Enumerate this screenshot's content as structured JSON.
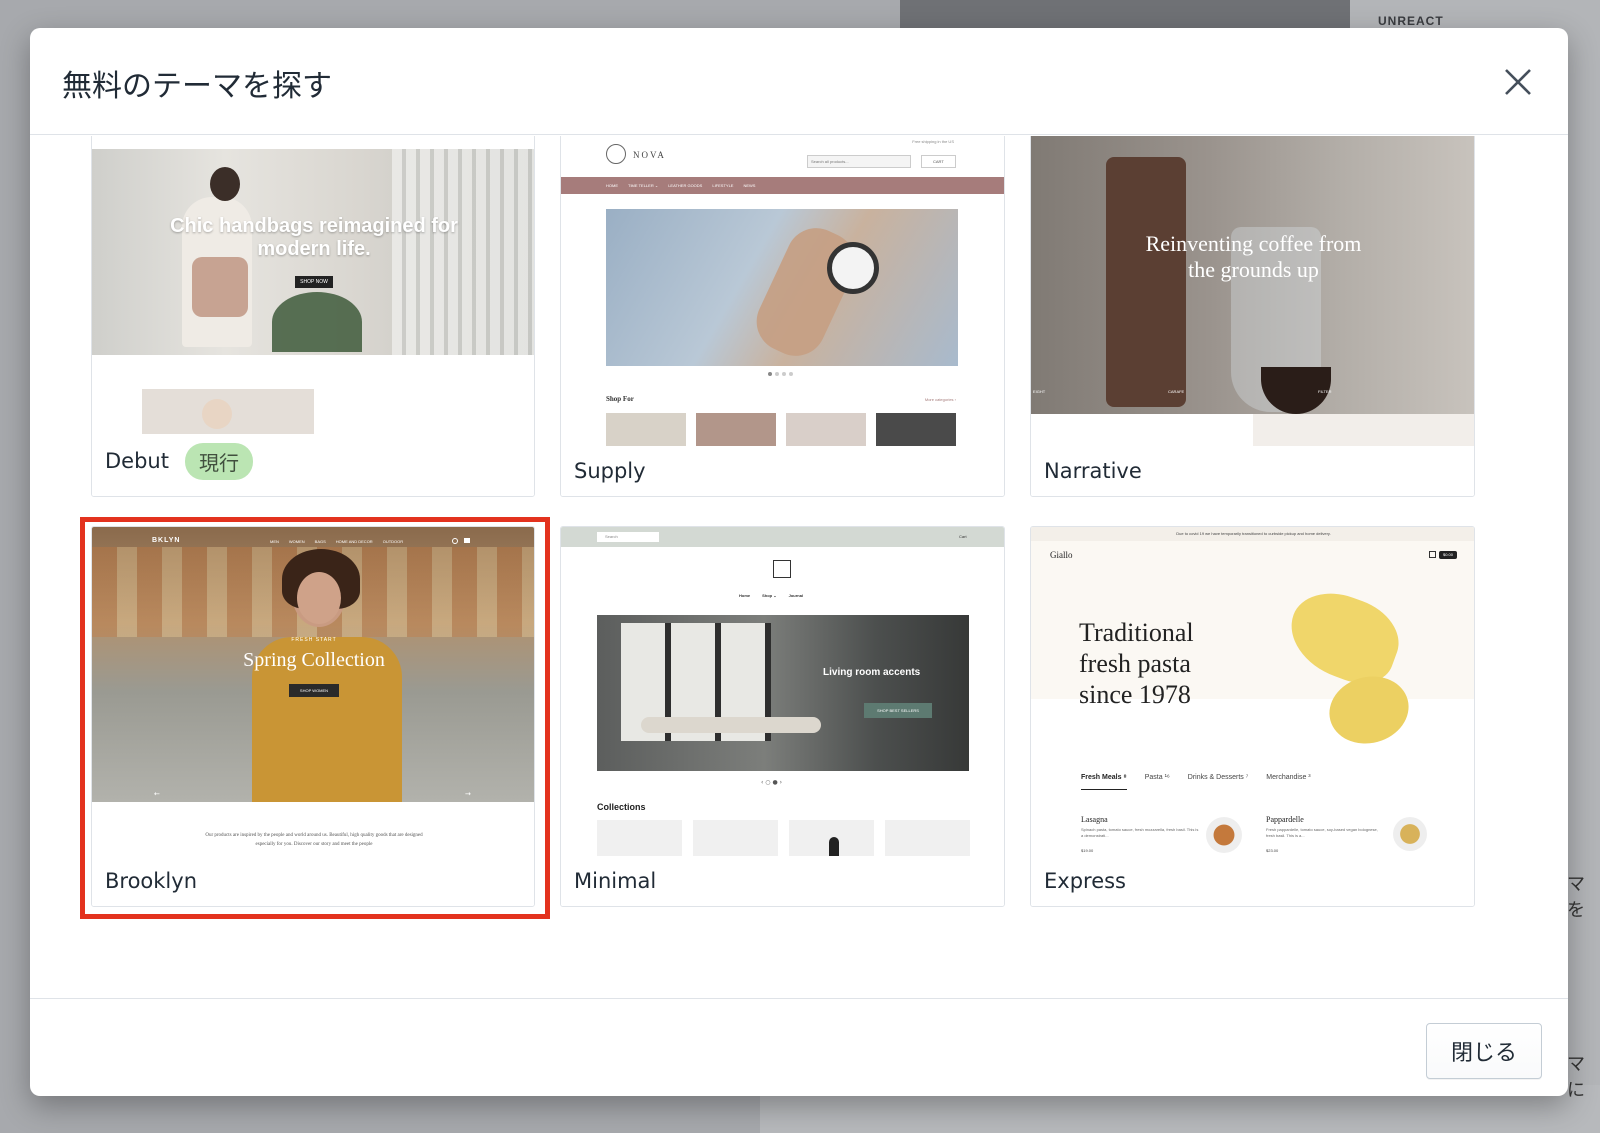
{
  "background": {
    "brand": "UNREACT",
    "peek_text_1": "マを",
    "peek_text_2": "マに"
  },
  "modal": {
    "title": "無料のテーマを探す",
    "close_button_label": "閉じる"
  },
  "themes": [
    {
      "name": "Debut",
      "badge": "現行",
      "preview": {
        "headline": "Chic handbags reimagined for modern life.",
        "cta": "SHOP NOW"
      }
    },
    {
      "name": "Supply",
      "preview": {
        "brand": "NOVA",
        "top_note": "Free shipping in the US",
        "search_placeholder": "Search all products...",
        "cart": "CART",
        "nav": [
          "HOME",
          "TIME TELLER ⌄",
          "LEATHER GOODS",
          "LIFESTYLE",
          "NEWS"
        ],
        "section_title": "Shop For",
        "section_link": "More categories ›"
      }
    },
    {
      "name": "Narrative",
      "preview": {
        "headline": "Reinventing coffee from the grounds up",
        "captions": [
          "EIGHT",
          "CARAFE",
          "FILTER"
        ]
      }
    },
    {
      "name": "Brooklyn",
      "selected": true,
      "preview": {
        "brand": "BKLYN",
        "nav": [
          "MEN",
          "WOMEN",
          "BAGS",
          "HOME AND DECOR",
          "OUTDOOR"
        ],
        "eyebrow": "FRESH START",
        "headline": "Spring Collection",
        "cta": "SHOP WOMEN",
        "body": "Our products are inspired by the people and world around us. Beautiful, high quality goods that are designed especially for you. Discover our story and meet the people"
      }
    },
    {
      "name": "Minimal",
      "preview": {
        "search": "Search",
        "cart": "Cart",
        "nav": [
          "Home",
          "Shop ⌄",
          "Journal"
        ],
        "hero_title": "Living room accents",
        "cta": "SHOP BEST SELLERS",
        "section_title": "Collections"
      }
    },
    {
      "name": "Express",
      "preview": {
        "banner": "Due to covid 19 we have temporarily transitioned to curbside pickup and home delivery.",
        "brand": "Giallo",
        "cart_badge": "$0.00",
        "headline": "Traditional fresh pasta since 1978",
        "tabs": [
          "Fresh Meals ⁸",
          "Pasta ¹⁶",
          "Drinks & Desserts ⁷",
          "Merchandise ³"
        ],
        "items": [
          {
            "name": "Lasagna",
            "desc": "Spinach pasta, tomato sauce, fresh mozzarella, fresh basil. This is a demonstrati...",
            "price": "$19.00"
          },
          {
            "name": "Pappardelle",
            "desc": "Fresh pappardelle, tomato sauce, soy-based vegan bolognese, fresh basil. This is a...",
            "price": "$23.00"
          }
        ]
      }
    }
  ],
  "colors": {
    "selected_outline": "#e3321e",
    "badge_bg": "#bbe5b3",
    "supply_nav": "#a67c7b",
    "minimal_topbar": "#d3d9d3"
  }
}
